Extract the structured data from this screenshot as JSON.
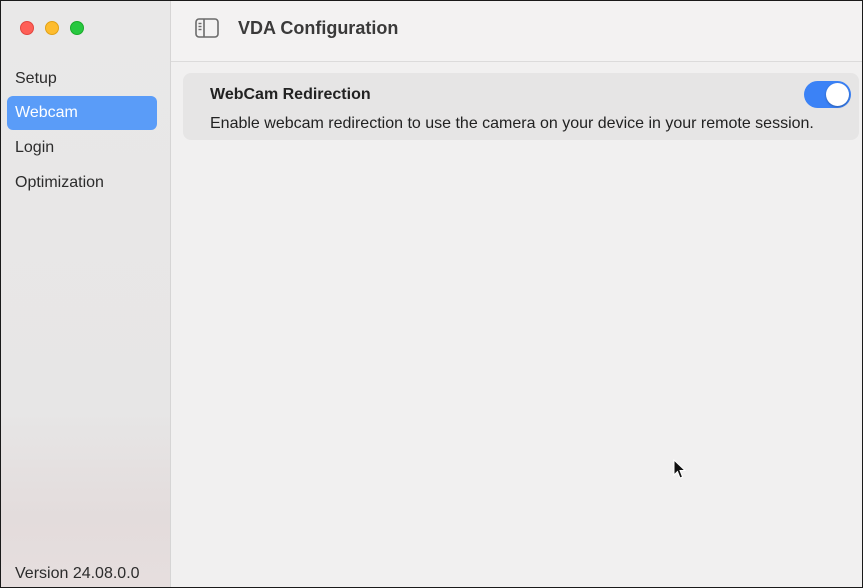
{
  "window": {
    "traffic_lights": [
      "close",
      "minimize",
      "zoom"
    ],
    "colors": {
      "close": "#fe5f57",
      "minimize": "#febc2e",
      "zoom": "#28c840",
      "accent": "#5a9cf8",
      "toggle_on": "#3b82f6"
    }
  },
  "sidebar": {
    "items": [
      {
        "label": "Setup",
        "active": false
      },
      {
        "label": "Webcam",
        "active": true
      },
      {
        "label": "Login",
        "active": false
      },
      {
        "label": "Optimization",
        "active": false
      }
    ],
    "version": "Version 24.08.0.0"
  },
  "toolbar": {
    "toggle_icon": "sidebar-toggle-icon",
    "title": "VDA Configuration"
  },
  "main": {
    "card": {
      "title": "WebCam Redirection",
      "description": "Enable webcam redirection to use the camera on your device in your remote session.",
      "toggle_on": true
    }
  }
}
